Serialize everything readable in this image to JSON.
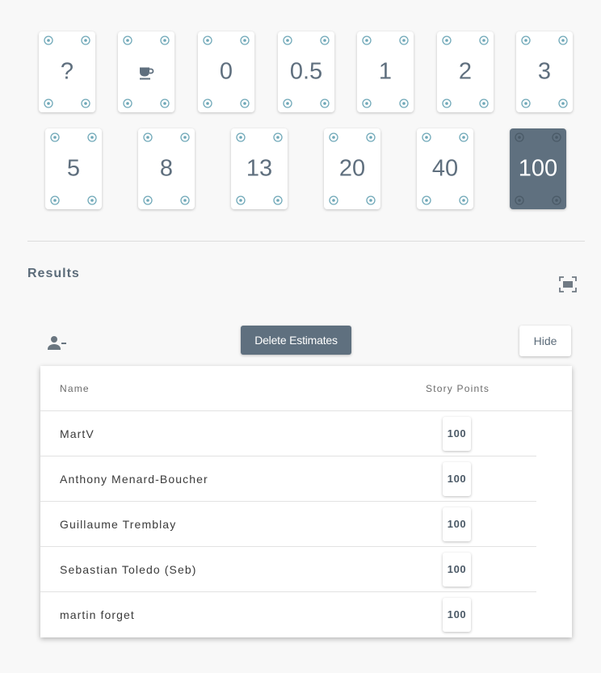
{
  "cards": [
    {
      "label": "?",
      "icon": "",
      "selected": false
    },
    {
      "label": "",
      "icon": "coffee-icon",
      "selected": false
    },
    {
      "label": "0",
      "icon": "",
      "selected": false
    },
    {
      "label": "0.5",
      "icon": "",
      "selected": false
    },
    {
      "label": "1",
      "icon": "",
      "selected": false
    },
    {
      "label": "2",
      "icon": "",
      "selected": false
    },
    {
      "label": "3",
      "icon": "",
      "selected": false
    },
    {
      "label": "5",
      "icon": "",
      "selected": false
    },
    {
      "label": "8",
      "icon": "",
      "selected": false
    },
    {
      "label": "13",
      "icon": "",
      "selected": false
    },
    {
      "label": "20",
      "icon": "",
      "selected": false
    },
    {
      "label": "40",
      "icon": "",
      "selected": false
    },
    {
      "label": "100",
      "icon": "",
      "selected": true
    }
  ],
  "results": {
    "title": "Results",
    "delete_label": "Delete Estimates",
    "hide_label": "Hide",
    "columns": {
      "name": "Name",
      "points": "Story Points"
    },
    "rows": [
      {
        "name": "MartV",
        "points": "100"
      },
      {
        "name": "Anthony Menard-Boucher",
        "points": "100"
      },
      {
        "name": "Guillaume Tremblay",
        "points": "100"
      },
      {
        "name": "Sebastian Toledo (Seb)",
        "points": "100"
      },
      {
        "name": "martin forget",
        "points": "100"
      }
    ]
  },
  "colors": {
    "accent": "#5f707f",
    "background": "#f8f8f8",
    "card": "#ffffff",
    "corner_icon": "#6fa8b8"
  }
}
